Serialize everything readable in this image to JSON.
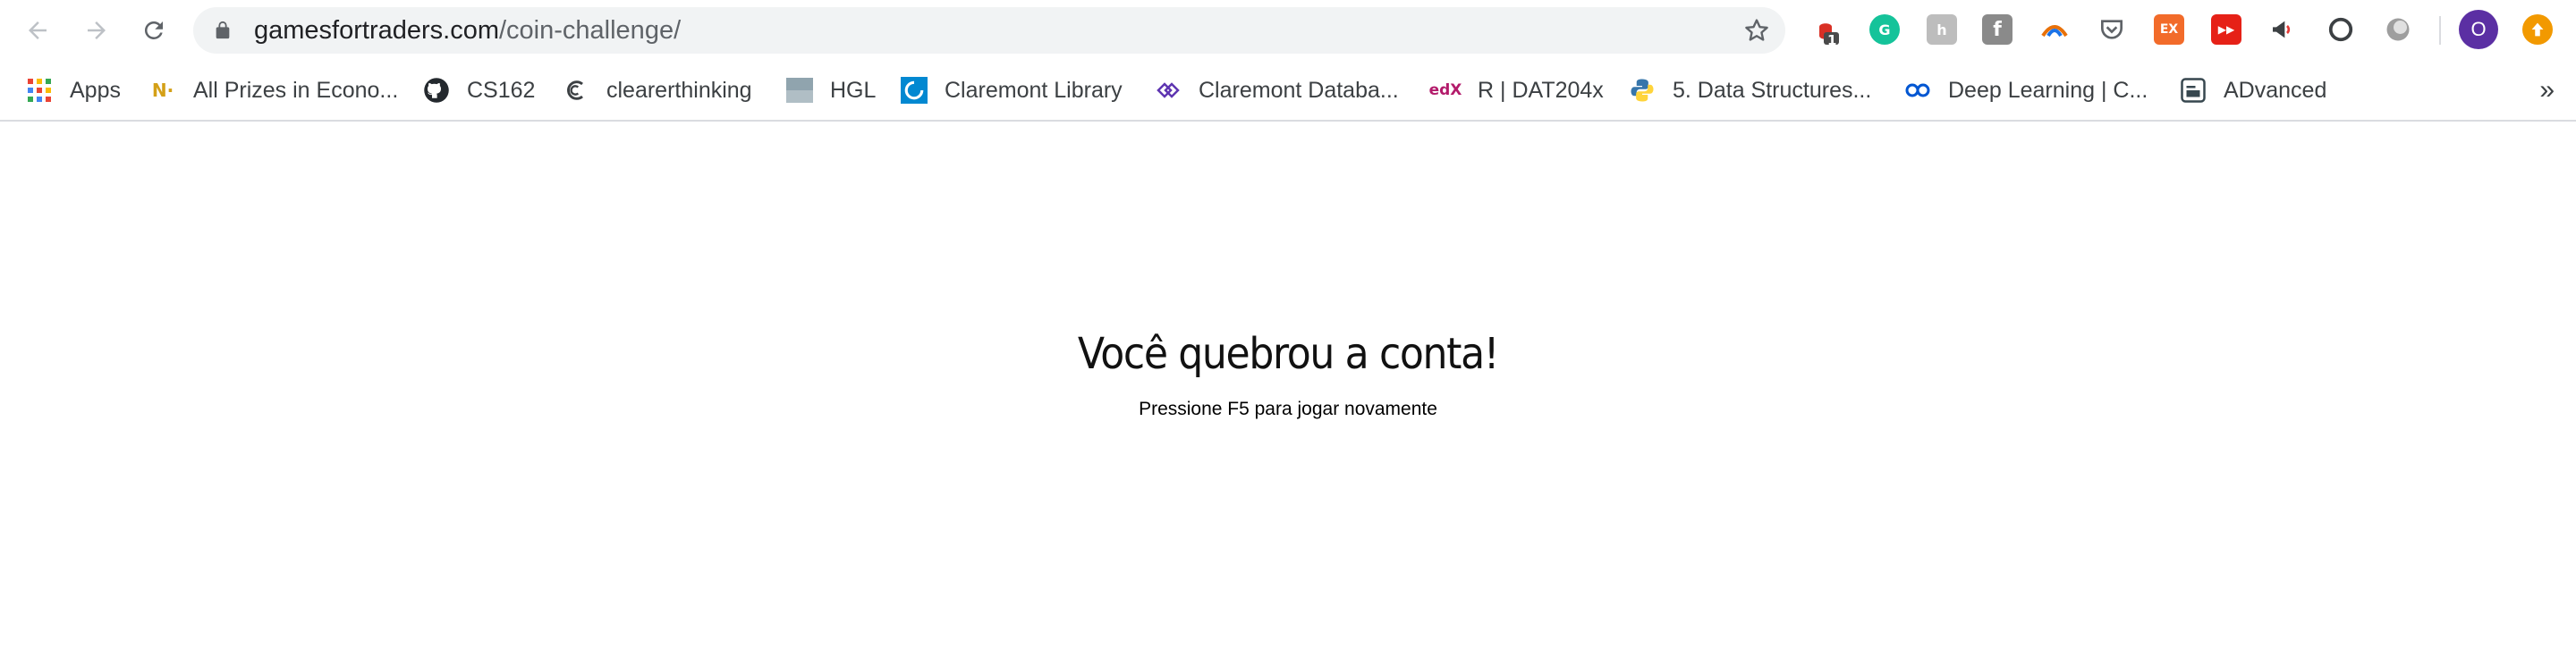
{
  "browser": {
    "url_domain": "gamesfortraders.com",
    "url_path": "/coin-challenge/",
    "extensions": [
      {
        "name": "Adblock",
        "badge": "1",
        "color": "#d93025"
      },
      {
        "name": "Grammarly",
        "glyph": "G",
        "color": "#15c39a"
      },
      {
        "name": "Hunter",
        "glyph": "h",
        "color": "#bdbdbd"
      },
      {
        "name": "Facebook",
        "glyph": "f",
        "color": "#8a8a8a"
      },
      {
        "name": "Pocket",
        "glyph": "",
        "color": "#5f6368"
      },
      {
        "name": "EX",
        "glyph": "EX",
        "color": "#f26b2a"
      },
      {
        "name": "YouTube",
        "glyph": "▶▶",
        "color": "#e62117"
      }
    ],
    "profile_initial": "O"
  },
  "bookmarks": [
    {
      "label": "Apps",
      "icon": "apps-grid-icon"
    },
    {
      "label": "All Prizes in Econo...",
      "icon": "n-icon",
      "glyph": "N·",
      "color": "#d4a017"
    },
    {
      "label": "CS162",
      "icon": "github-icon"
    },
    {
      "label": "clearerthinking",
      "icon": "clearerthinking-icon"
    },
    {
      "label": "HGL",
      "icon": "hgl-icon"
    },
    {
      "label": "Claremont Library",
      "icon": "claremont-library-icon"
    },
    {
      "label": "Claremont Databa...",
      "icon": "claremont-database-icon"
    },
    {
      "label": "R | DAT204x",
      "icon": "edx-icon",
      "glyph": "edX"
    },
    {
      "label": "5. Data Structures...",
      "icon": "python-icon"
    },
    {
      "label": "Deep Learning | C...",
      "icon": "coursera-icon"
    },
    {
      "label": "ADvanced",
      "icon": "advanced-icon"
    }
  ],
  "overflow_label": "»",
  "page": {
    "title": "Você quebrou a conta!",
    "subtitle": "Pressione F5 para jogar novamente"
  }
}
